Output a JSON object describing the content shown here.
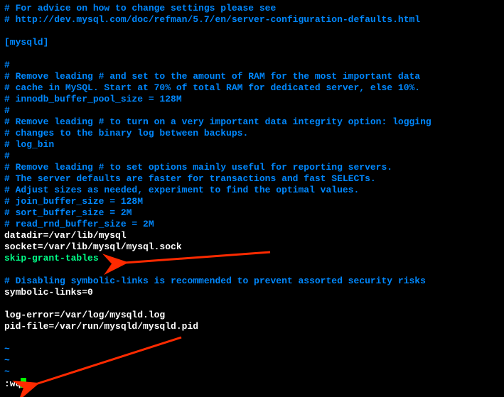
{
  "lines": {
    "c1": "# For advice on how to change settings please see",
    "c2": "# http://dev.mysql.com/doc/refman/5.7/en/server-configuration-defaults.html",
    "section": "[mysqld]",
    "c3": "#",
    "c4": "# Remove leading # and set to the amount of RAM for the most important data",
    "c5": "# cache in MySQL. Start at 70% of total RAM for dedicated server, else 10%.",
    "c6": "# innodb_buffer_pool_size = 128M",
    "c7": "#",
    "c8": "# Remove leading # to turn on a very important data integrity option: logging",
    "c9": "# changes to the binary log between backups.",
    "c10": "# log_bin",
    "c11": "#",
    "c12": "# Remove leading # to set options mainly useful for reporting servers.",
    "c13": "# The server defaults are faster for transactions and fast SELECTs.",
    "c14": "# Adjust sizes as needed, experiment to find the optimal values.",
    "c15": "# join_buffer_size = 128M",
    "c16": "# sort_buffer_size = 2M",
    "c17": "# read_rnd_buffer_size = 2M",
    "cfg1": "datadir=/var/lib/mysql",
    "cfg2": "socket=/var/lib/mysql/mysql.sock",
    "hl1": "skip-grant-tables",
    "c18": "# Disabling symbolic-links is recommended to prevent assorted security risks",
    "cfg3": "symbolic-links=0",
    "cfg4": "log-error=/var/log/mysqld.log",
    "cfg5": "pid-file=/var/run/mysqld/mysqld.pid",
    "tilde": "~",
    "cmd": ":wq"
  },
  "annotations": {
    "arrow1_target": "skip-grant-tables",
    "arrow2_target": ":wq"
  }
}
